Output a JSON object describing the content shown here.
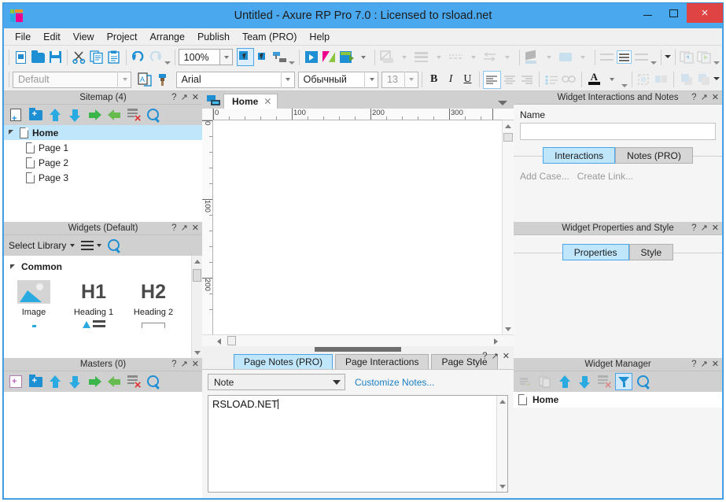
{
  "window": {
    "title": "Untitled - Axure RP Pro 7.0 : Licensed to rsload.net",
    "minimize_label": "–",
    "maximize_label": "□",
    "close_label": "×",
    "accent_color": "#4aa8ee",
    "close_color": "#e04343"
  },
  "menubar": {
    "items": [
      {
        "label": "File"
      },
      {
        "label": "Edit"
      },
      {
        "label": "View"
      },
      {
        "label": "Project"
      },
      {
        "label": "Arrange"
      },
      {
        "label": "Publish"
      },
      {
        "label": "Team (PRO)"
      },
      {
        "label": "Help"
      }
    ]
  },
  "toolbar": {
    "zoom_value": "100%",
    "style_value": "Default",
    "style_placeholder": "Default",
    "font_family": "Arial",
    "font_style": "Обычный",
    "font_size": "13",
    "bold_label": "B",
    "italic_label": "I",
    "underline_label": "U",
    "font_color_label": "A"
  },
  "sitemap": {
    "title": "Sitemap (4)",
    "help_label": "?",
    "popout_label": "↗",
    "close_label": "✕",
    "tools": [
      "add-page-icon",
      "add-folder-icon",
      "move-up-icon",
      "move-down-icon",
      "indent-right-icon",
      "outdent-left-icon",
      "delete-icon",
      "search-icon"
    ],
    "nodes": [
      {
        "label": "Home",
        "selected": true,
        "indent": 0
      },
      {
        "label": "Page 1",
        "selected": false,
        "indent": 1
      },
      {
        "label": "Page 2",
        "selected": false,
        "indent": 1
      },
      {
        "label": "Page 3",
        "selected": false,
        "indent": 1
      }
    ]
  },
  "widgets": {
    "title": "Widgets (Default)",
    "help_label": "?",
    "popout_label": "↗",
    "close_label": "✕",
    "select_library_label": "Select Library",
    "category": "Common",
    "items": [
      {
        "label": "Image",
        "icon": "image-widget-icon"
      },
      {
        "label": "Heading 1",
        "icon": "h1-widget-icon",
        "glyph": "H1"
      },
      {
        "label": "Heading 2",
        "icon": "h2-widget-icon",
        "glyph": "H2"
      }
    ]
  },
  "masters": {
    "title": "Masters (0)",
    "help_label": "?",
    "popout_label": "↗",
    "close_label": "✕",
    "tools": [
      "add-master-icon",
      "add-folder-icon",
      "move-up-icon",
      "move-down-icon",
      "indent-right-icon",
      "outdent-left-icon",
      "delete-icon",
      "search-icon"
    ]
  },
  "canvas": {
    "tab_label": "Home",
    "tab_close_label": "✕",
    "ruler_h_ticks": [
      "0",
      "100",
      "200",
      "300"
    ],
    "ruler_v_ticks": [
      "0",
      "100",
      "200"
    ]
  },
  "page_notes": {
    "tabs": [
      {
        "label": "Page Notes (PRO)",
        "active": true
      },
      {
        "label": "Page Interactions",
        "active": false
      },
      {
        "label": "Page Style",
        "active": false
      }
    ],
    "help_label": "?",
    "popout_label": "↗",
    "close_label": "✕",
    "note_select_value": "Note",
    "customize_link": "Customize Notes...",
    "note_text": "RSLOAD.NET"
  },
  "widget_interactions": {
    "title": "Widget Interactions and Notes",
    "help_label": "?",
    "popout_label": "↗",
    "close_label": "✕",
    "name_label": "Name",
    "name_value": "",
    "tabs": [
      {
        "label": "Interactions",
        "active": true
      },
      {
        "label": "Notes (PRO)",
        "active": false
      }
    ],
    "actions": [
      "Add Case...",
      "Create Link..."
    ]
  },
  "widget_properties": {
    "title": "Widget Properties and Style",
    "help_label": "?",
    "popout_label": "↗",
    "close_label": "✕",
    "tabs": [
      {
        "label": "Properties",
        "active": true
      },
      {
        "label": "Style",
        "active": false
      }
    ]
  },
  "widget_manager": {
    "title": "Widget Manager",
    "help_label": "?",
    "popout_label": "↗",
    "close_label": "✕",
    "tools": [
      "add-icon",
      "duplicate-icon",
      "move-up-icon",
      "move-down-icon",
      "delete-icon",
      "filter-icon",
      "search-icon"
    ],
    "rows": [
      {
        "label": "Home"
      }
    ]
  }
}
